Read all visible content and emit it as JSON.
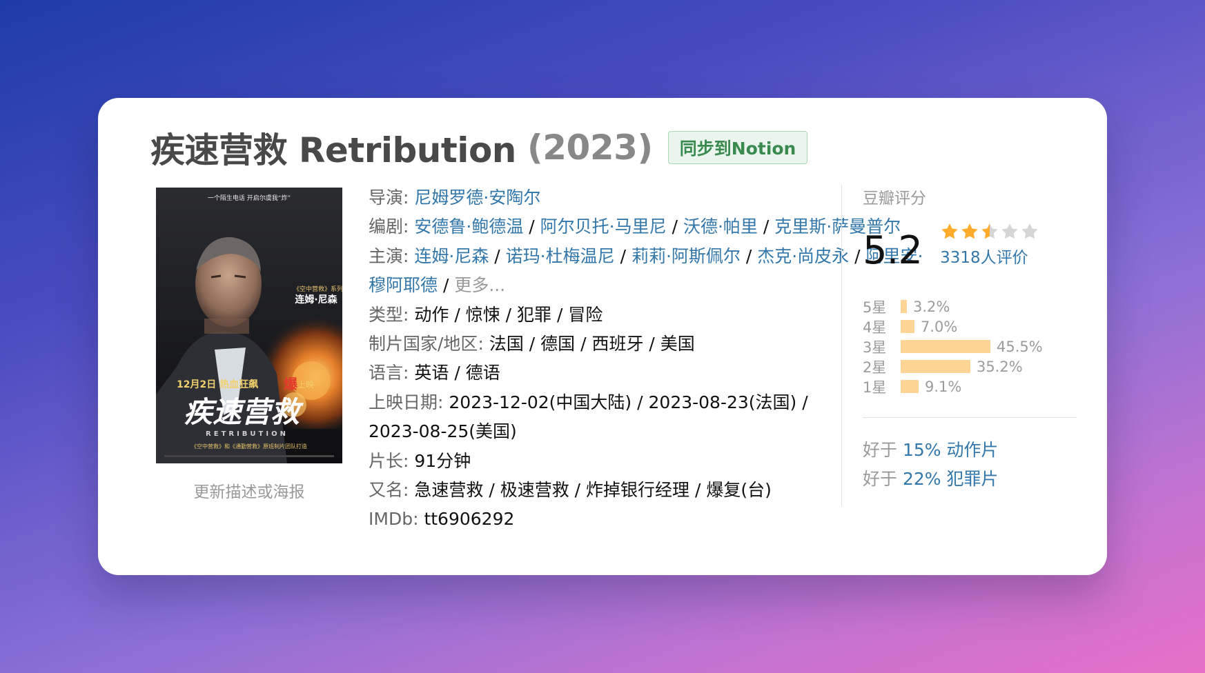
{
  "movie": {
    "title": "疾速营救 Retribution",
    "year": "(2023)",
    "sync_label": "同步到Notion",
    "update_label": "更新描述或海报"
  },
  "poster": {
    "tagline": "一个陌生电话  开启尔虞我“炸”",
    "series": "《空中营救》系列",
    "actor": "连姆·尼森",
    "release": "12月2日 热血狂飙",
    "hot": "爆",
    "release_tail": "上映",
    "title_cn": "疾速营救",
    "title_en": "RETRIBUTION",
    "credits": "《空中营救》和《通勤营救》原班制片团队打造"
  },
  "info": {
    "director_label": "导演",
    "directors": [
      "尼姆罗德·安陶尔"
    ],
    "writer_label": "编剧",
    "writers": [
      "安德鲁·鲍德温",
      "阿尔贝托·马里尼",
      "沃德·帕里",
      "克里斯·萨曼普尔"
    ],
    "cast_label": "主演",
    "cast": [
      "连姆·尼森",
      "诺玛·杜梅温尼",
      "莉莉·阿斯佩尔",
      "杰克·尚皮永",
      "阿里安·穆阿耶德"
    ],
    "more_label": "更多...",
    "genre_label": "类型",
    "genre": "动作 / 惊悚 / 犯罪 / 冒险",
    "country_label": "制片国家/地区",
    "country": "法国 / 德国 / 西班牙 / 美国",
    "language_label": "语言",
    "language": "英语 / 德语",
    "release_label": "上映日期",
    "release_line1": "2023-12-02(中国大陆) / 2023-08-23(法国) /",
    "release_line2": "2023-08-25(美国)",
    "runtime_label": "片长",
    "runtime": "91分钟",
    "aka_label": "又名",
    "aka": "急速营救 / 极速营救 / 炸掉银行经理 / 爆复(台)",
    "imdb_label": "IMDb",
    "imdb": "tt6906292"
  },
  "rating": {
    "label": "豆瓣评分",
    "score": "5.2",
    "stars": 2.5,
    "votes": "3318人评价",
    "star_color": "#ffac2d",
    "breakdown": [
      {
        "label": "5星",
        "pct": "3.2%",
        "value": 3.2
      },
      {
        "label": "4星",
        "pct": "7.0%",
        "value": 7.0
      },
      {
        "label": "3星",
        "pct": "45.5%",
        "value": 45.5
      },
      {
        "label": "2星",
        "pct": "35.2%",
        "value": 35.2
      },
      {
        "label": "1星",
        "pct": "9.1%",
        "value": 9.1
      }
    ],
    "better_than": [
      {
        "prefix": "好于",
        "text": "15% 动作片"
      },
      {
        "prefix": "好于",
        "text": "22% 犯罪片"
      }
    ]
  }
}
